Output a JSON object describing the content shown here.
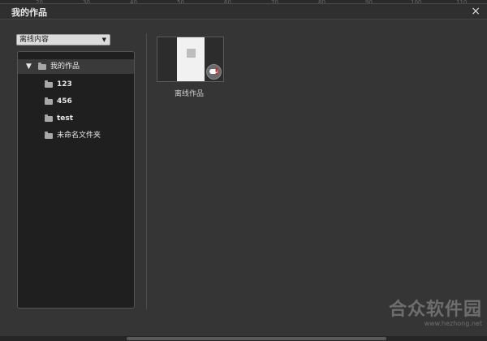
{
  "ruler": {
    "ticks": [
      "20",
      "30",
      "40",
      "50",
      "60",
      "70",
      "80",
      "90",
      "100",
      "110"
    ]
  },
  "dialog": {
    "title": "我的作品",
    "close_label": "×"
  },
  "dropdown": {
    "selected": "离线内容",
    "arrow": "▼"
  },
  "tree": {
    "root": {
      "label": "我的作品",
      "expander": "▼"
    },
    "items": [
      {
        "label": "123"
      },
      {
        "label": "456"
      },
      {
        "label": "test"
      },
      {
        "label": "未命名文件夹"
      }
    ]
  },
  "thumbnail": {
    "label": "离线作品",
    "badge_mark": "!"
  },
  "watermark": {
    "big": "合众软件园",
    "small": "www.hezhong.net"
  }
}
